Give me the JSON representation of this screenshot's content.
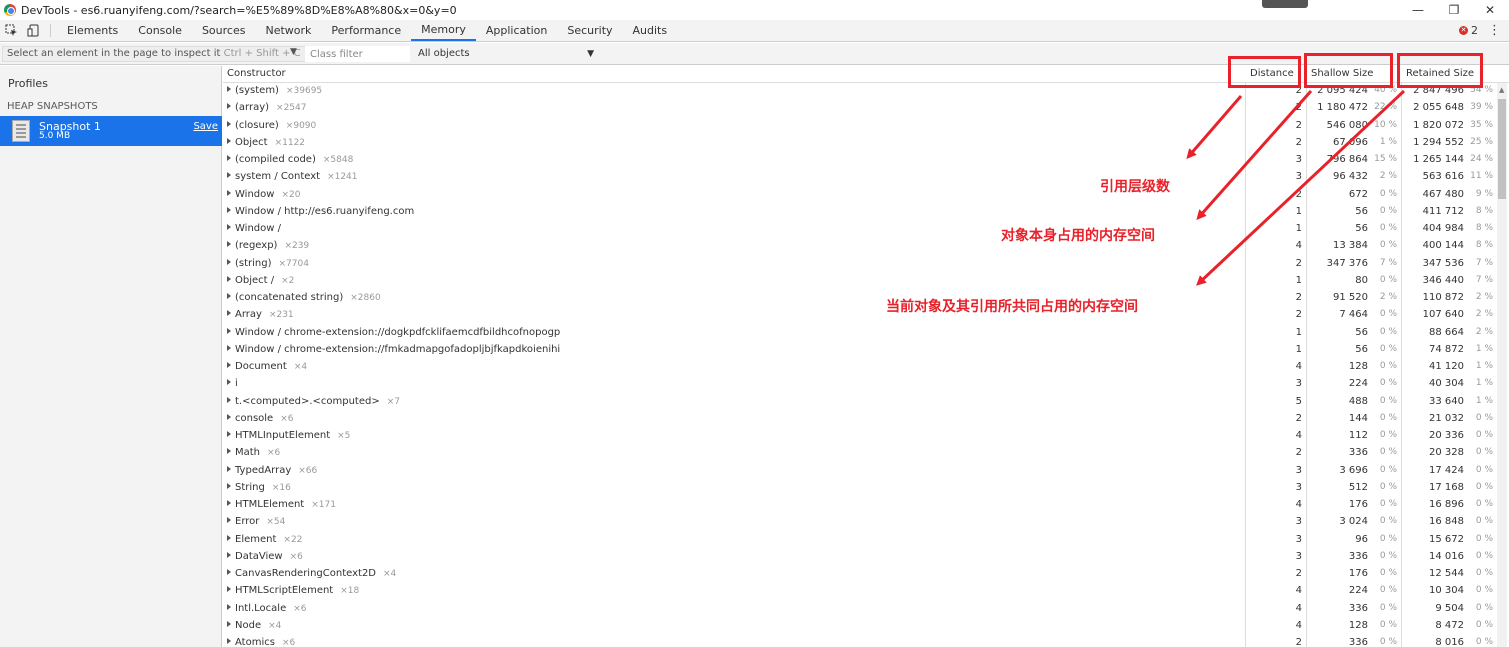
{
  "window": {
    "title": "DevTools - es6.ruanyifeng.com/?search=%E5%89%8D%E8%A8%80&x=0&y=0",
    "controls": [
      "—",
      "❐",
      "✕"
    ]
  },
  "tabs": [
    "Elements",
    "Console",
    "Sources",
    "Network",
    "Performance",
    "Memory",
    "Application",
    "Security",
    "Audits"
  ],
  "active_tab": "Memory",
  "error_count": "2",
  "toolbar": {
    "inspect_tooltip": "Select an element in the page to inspect it",
    "inspect_shortcut": "Ctrl + Shift + C",
    "class_filter_placeholder": "Class filter",
    "objects_select": "All objects"
  },
  "sidebar": {
    "profiles_label": "Profiles",
    "section_header": "HEAP SNAPSHOTS",
    "snapshot": {
      "name": "Snapshot 1",
      "size": "5.0 MB",
      "save_label": "Save"
    }
  },
  "columns": {
    "constructor": "Constructor",
    "distance": "Distance",
    "shallow": "Shallow Size",
    "retained": "Retained Size"
  },
  "rows": [
    {
      "name": "(system)",
      "count": "×39695",
      "distance": "2",
      "shallow": "2 095 424",
      "shallow_pct": "40 %",
      "retained": "2 847 496",
      "retained_pct": "54 %"
    },
    {
      "name": "(array)",
      "count": "×2547",
      "distance": "2",
      "shallow": "1 180 472",
      "shallow_pct": "22 %",
      "retained": "2 055 648",
      "retained_pct": "39 %"
    },
    {
      "name": "(closure)",
      "count": "×9090",
      "distance": "2",
      "shallow": "546 080",
      "shallow_pct": "10 %",
      "retained": "1 820 072",
      "retained_pct": "35 %"
    },
    {
      "name": "Object",
      "count": "×1122",
      "distance": "2",
      "shallow": "67 096",
      "shallow_pct": "1 %",
      "retained": "1 294 552",
      "retained_pct": "25 %"
    },
    {
      "name": "(compiled code)",
      "count": "×5848",
      "distance": "3",
      "shallow": "796 864",
      "shallow_pct": "15 %",
      "retained": "1 265 144",
      "retained_pct": "24 %"
    },
    {
      "name": "system / Context",
      "count": "×1241",
      "distance": "3",
      "shallow": "96 432",
      "shallow_pct": "2 %",
      "retained": "563 616",
      "retained_pct": "11 %"
    },
    {
      "name": "Window",
      "count": "×20",
      "distance": "2",
      "shallow": "672",
      "shallow_pct": "0 %",
      "retained": "467 480",
      "retained_pct": "9 %"
    },
    {
      "name": "Window / http://es6.ruanyifeng.com",
      "count": "",
      "distance": "1",
      "shallow": "56",
      "shallow_pct": "0 %",
      "retained": "411 712",
      "retained_pct": "8 %"
    },
    {
      "name": "Window /",
      "count": "",
      "distance": "1",
      "shallow": "56",
      "shallow_pct": "0 %",
      "retained": "404 984",
      "retained_pct": "8 %"
    },
    {
      "name": "(regexp)",
      "count": "×239",
      "distance": "4",
      "shallow": "13 384",
      "shallow_pct": "0 %",
      "retained": "400 144",
      "retained_pct": "8 %"
    },
    {
      "name": "(string)",
      "count": "×7704",
      "distance": "2",
      "shallow": "347 376",
      "shallow_pct": "7 %",
      "retained": "347 536",
      "retained_pct": "7 %"
    },
    {
      "name": "Object /",
      "count": "×2",
      "distance": "1",
      "shallow": "80",
      "shallow_pct": "0 %",
      "retained": "346 440",
      "retained_pct": "7 %"
    },
    {
      "name": "(concatenated string)",
      "count": "×2860",
      "distance": "2",
      "shallow": "91 520",
      "shallow_pct": "2 %",
      "retained": "110 872",
      "retained_pct": "2 %"
    },
    {
      "name": "Array",
      "count": "×231",
      "distance": "2",
      "shallow": "7 464",
      "shallow_pct": "0 %",
      "retained": "107 640",
      "retained_pct": "2 %"
    },
    {
      "name": "Window / chrome-extension://dogkpdfcklifaemcdfbildhcofnopogp",
      "count": "",
      "distance": "1",
      "shallow": "56",
      "shallow_pct": "0 %",
      "retained": "88 664",
      "retained_pct": "2 %"
    },
    {
      "name": "Window / chrome-extension://fmkadmapgofadopljbjfkapdkoienihi",
      "count": "",
      "distance": "1",
      "shallow": "56",
      "shallow_pct": "0 %",
      "retained": "74 872",
      "retained_pct": "1 %"
    },
    {
      "name": "Document",
      "count": "×4",
      "distance": "4",
      "shallow": "128",
      "shallow_pct": "0 %",
      "retained": "41 120",
      "retained_pct": "1 %"
    },
    {
      "name": "i",
      "count": "",
      "distance": "3",
      "shallow": "224",
      "shallow_pct": "0 %",
      "retained": "40 304",
      "retained_pct": "1 %"
    },
    {
      "name": "t.<computed>.<computed>",
      "count": "×7",
      "distance": "5",
      "shallow": "488",
      "shallow_pct": "0 %",
      "retained": "33 640",
      "retained_pct": "1 %"
    },
    {
      "name": "console",
      "count": "×6",
      "distance": "2",
      "shallow": "144",
      "shallow_pct": "0 %",
      "retained": "21 032",
      "retained_pct": "0 %"
    },
    {
      "name": "HTMLInputElement",
      "count": "×5",
      "distance": "4",
      "shallow": "112",
      "shallow_pct": "0 %",
      "retained": "20 336",
      "retained_pct": "0 %"
    },
    {
      "name": "Math",
      "count": "×6",
      "distance": "2",
      "shallow": "336",
      "shallow_pct": "0 %",
      "retained": "20 328",
      "retained_pct": "0 %"
    },
    {
      "name": "TypedArray",
      "count": "×66",
      "distance": "3",
      "shallow": "3 696",
      "shallow_pct": "0 %",
      "retained": "17 424",
      "retained_pct": "0 %"
    },
    {
      "name": "String",
      "count": "×16",
      "distance": "3",
      "shallow": "512",
      "shallow_pct": "0 %",
      "retained": "17 168",
      "retained_pct": "0 %"
    },
    {
      "name": "HTMLElement",
      "count": "×171",
      "distance": "4",
      "shallow": "176",
      "shallow_pct": "0 %",
      "retained": "16 896",
      "retained_pct": "0 %"
    },
    {
      "name": "Error",
      "count": "×54",
      "distance": "3",
      "shallow": "3 024",
      "shallow_pct": "0 %",
      "retained": "16 848",
      "retained_pct": "0 %"
    },
    {
      "name": "Element",
      "count": "×22",
      "distance": "3",
      "shallow": "96",
      "shallow_pct": "0 %",
      "retained": "15 672",
      "retained_pct": "0 %"
    },
    {
      "name": "DataView",
      "count": "×6",
      "distance": "3",
      "shallow": "336",
      "shallow_pct": "0 %",
      "retained": "14 016",
      "retained_pct": "0 %"
    },
    {
      "name": "CanvasRenderingContext2D",
      "count": "×4",
      "distance": "2",
      "shallow": "176",
      "shallow_pct": "0 %",
      "retained": "12 544",
      "retained_pct": "0 %"
    },
    {
      "name": "HTMLScriptElement",
      "count": "×18",
      "distance": "4",
      "shallow": "224",
      "shallow_pct": "0 %",
      "retained": "10 304",
      "retained_pct": "0 %"
    },
    {
      "name": "Intl.Locale",
      "count": "×6",
      "distance": "4",
      "shallow": "336",
      "shallow_pct": "0 %",
      "retained": "9 504",
      "retained_pct": "0 %"
    },
    {
      "name": "Node",
      "count": "×4",
      "distance": "4",
      "shallow": "128",
      "shallow_pct": "0 %",
      "retained": "8 472",
      "retained_pct": "0 %"
    },
    {
      "name": "Atomics",
      "count": "×6",
      "distance": "2",
      "shallow": "336",
      "shallow_pct": "0 %",
      "retained": "8 016",
      "retained_pct": "0 %"
    }
  ],
  "annotations": {
    "distance": "引用层级数",
    "shallow": "对象本身占用的内存空间",
    "retained": "当前对象及其引用所共同占用的内存空间"
  },
  "colors": {
    "annotation": "#e8212a",
    "selection": "#1a73e8"
  }
}
